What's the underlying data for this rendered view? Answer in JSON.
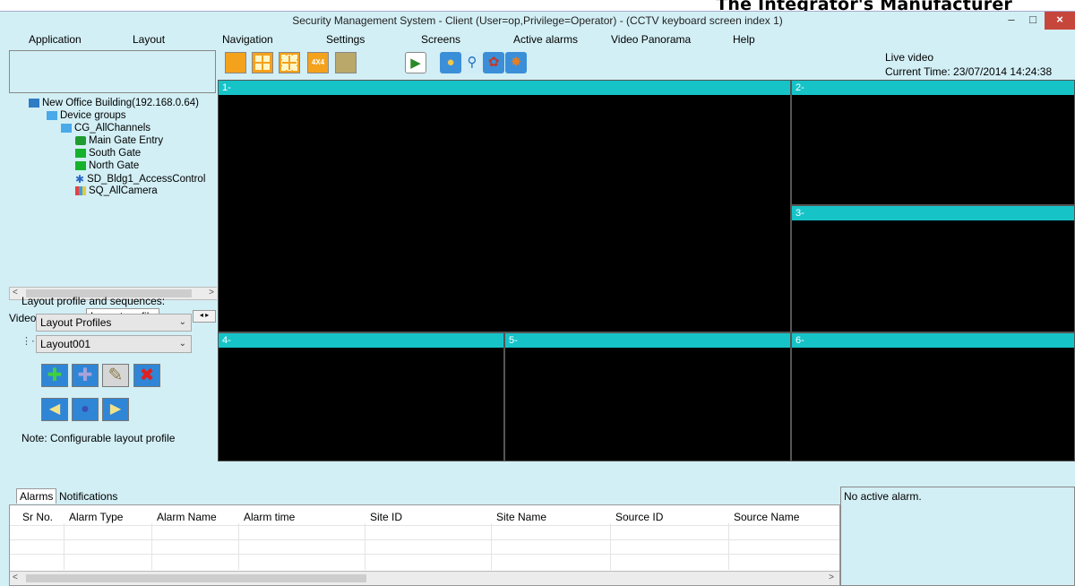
{
  "watermark": "The Integrator's Manufacturer",
  "window": {
    "title": "Security Management System - Client (User=op,Privilege=Operator) - (CCTV keyboard screen index 1)",
    "minimize": "–",
    "maximize": "□",
    "close": "×"
  },
  "menu": [
    "Application",
    "Layout",
    "Navigation",
    "Settings",
    "Screens",
    "Active alarms",
    "Video Panorama",
    "Help"
  ],
  "toolbar": {
    "layout_4x4_label": "4X4",
    "icons": [
      "single-layout-icon",
      "2x2-layout-icon",
      "3x3-layout-icon",
      "4x4-layout-icon",
      "custom-layout-icon",
      "play-sequence-icon",
      "globe-icon",
      "search-icon",
      "film-reel-icon",
      "film-reel-star-icon"
    ]
  },
  "header": {
    "live_video": "Live video",
    "current_time": "Current Time:   23/07/2014 14:24:38"
  },
  "tree": {
    "root": "New Office Building(192.168.0.64)",
    "device_groups": "Device groups",
    "channel_group": "CG_AllChannels",
    "items": [
      "Main Gate Entry",
      "South Gate",
      "North Gate",
      "SD_Bldg1_AccessControl",
      "SQ_AllCamera"
    ]
  },
  "left_tabs": [
    "Video source",
    "Layout profile"
  ],
  "layout_profile": {
    "heading": "Layout profile and sequences:",
    "profiles_select": "Layout Profiles",
    "layout_select": "Layout001",
    "note": "Note: Configurable layout profile"
  },
  "video_tiles": [
    "1-",
    "2-",
    "3-",
    "4-",
    "5-",
    "6-"
  ],
  "bottom_tabs": [
    "Alarms",
    "Notifications"
  ],
  "alarm_table": {
    "columns": [
      "Sr No.",
      "Alarm Type",
      "Alarm Name",
      "Alarm time",
      "Site ID",
      "Site Name",
      "Source ID",
      "Source Name"
    ]
  },
  "alarm_status": "No active alarm.",
  "colors": {
    "panel_bg": "#d2eff5",
    "tile_header": "#16c4c8",
    "tile_bg": "#000000",
    "layout_button": "#f4a21c",
    "close_button": "#c7463c"
  }
}
